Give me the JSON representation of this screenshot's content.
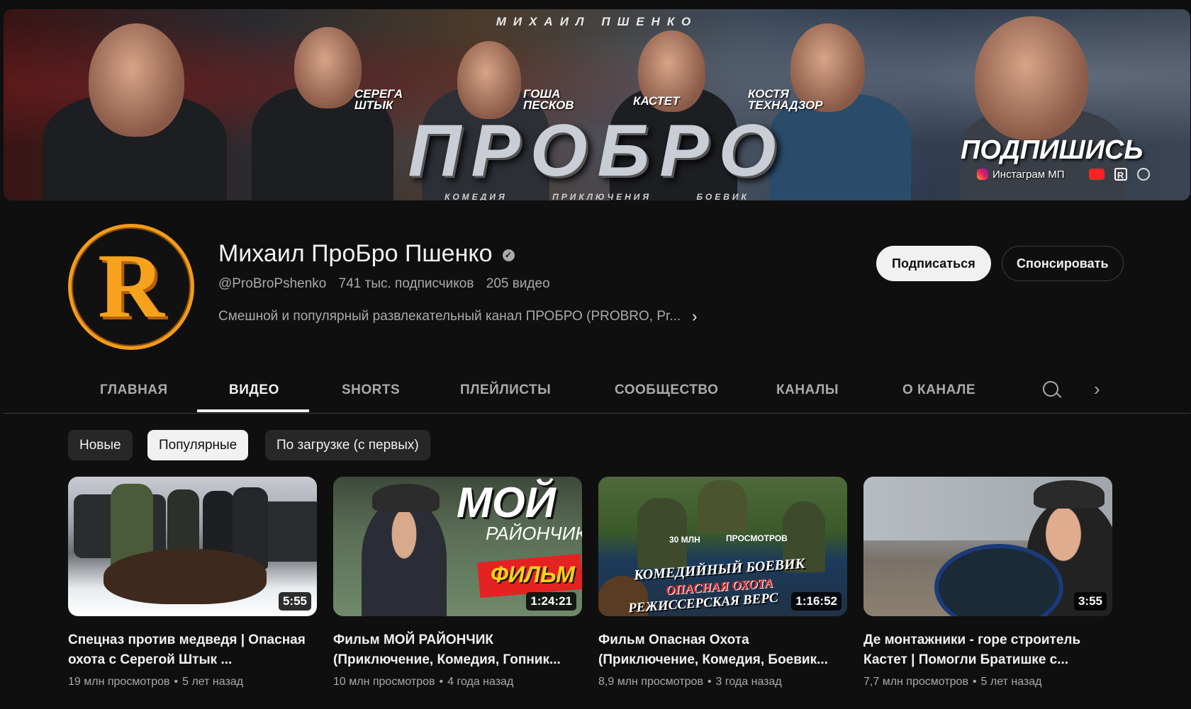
{
  "banner": {
    "top_text": "МИХАИЛ ПШЕНКО",
    "title": "ПРОБРО",
    "genres": [
      "КОМЕДИЯ",
      "ПРИКЛЮЧЕНИЯ",
      "БОЕВИК"
    ],
    "characters": [
      "СЕРЕГА ШТЫК",
      "ГОША ПЕСКОВ",
      "КАСТЕТ",
      "КОСТЯ ТЕХНАДЗОР"
    ],
    "subscribe_text": "ПОДПИШИСЬ",
    "link_label": "Инстаграм МП"
  },
  "channel": {
    "avatar_letter": "R",
    "name": "Михаил ПроБро Пшенко",
    "handle": "@ProBroPshenko",
    "subscribers": "741 тыс. подписчиков",
    "video_count": "205 видео",
    "description": "Смешной и популярный развлекательный канал ПРОБРО (PROBRO, Pr...",
    "subscribe_button": "Подписаться",
    "sponsor_button": "Спонсировать"
  },
  "tabs": [
    {
      "label": "ГЛАВНАЯ"
    },
    {
      "label": "ВИДЕО"
    },
    {
      "label": "SHORTS"
    },
    {
      "label": "ПЛЕЙЛИСТЫ"
    },
    {
      "label": "СООБЩЕСТВО"
    },
    {
      "label": "КАНАЛЫ"
    },
    {
      "label": "О КАНАЛЕ"
    }
  ],
  "active_tab": "ВИДЕО",
  "chips": [
    {
      "label": "Новые"
    },
    {
      "label": "Популярные"
    },
    {
      "label": "По загрузке (с первых)"
    }
  ],
  "active_chip": "Популярные",
  "videos": [
    {
      "title": "Спецназ против медведя | Опасная охота с Серегой Штык ...",
      "views": "19 млн просмотров",
      "age": "5 лет назад",
      "duration": "5:55"
    },
    {
      "title": "Фильм МОЙ РАЙОНЧИК (Приключение, Комедия, Гопник...",
      "views": "10 млн просмотров",
      "age": "4 года назад",
      "duration": "1:24:21",
      "thumb_text": [
        "МОЙ",
        "РАЙОНЧИК",
        "ФИЛЬМ"
      ]
    },
    {
      "title": "Фильм Опасная Охота (Приключение, Комедия, Боевик...",
      "views": "8,9 млн просмотров",
      "age": "3 года назад",
      "duration": "1:16:52",
      "thumb_text": [
        "30 МЛН",
        "ПРОСМОТРОВ",
        "КОМЕДИЙНЫЙ БОЕВИК",
        "ОПАСНАЯ ОХОТА",
        "РЕЖИССЕРСКАЯ ВЕРС"
      ]
    },
    {
      "title": "Де монтажники - горе строитель Кастет | Помогли Братишке с...",
      "views": "7,7 млн просмотров",
      "age": "5 лет назад",
      "duration": "3:55"
    }
  ],
  "colors": {
    "background": "#0f0f0f",
    "text_primary": "#f1f1f1",
    "text_secondary": "#aaaaaa",
    "chip_bg": "#272727",
    "avatar_accent": "#f39c1a"
  }
}
